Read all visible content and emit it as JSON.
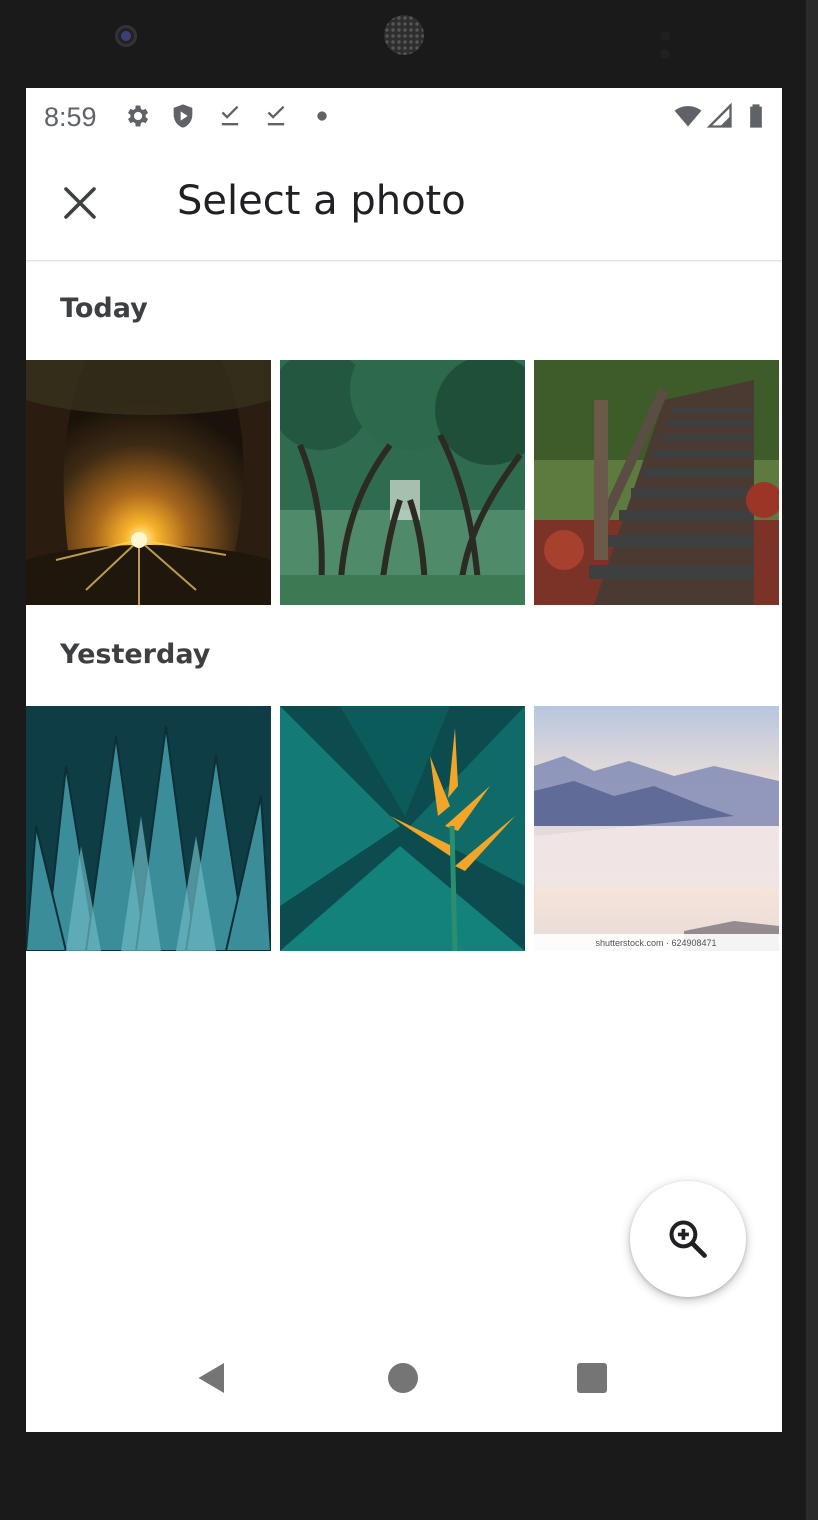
{
  "status_bar": {
    "time": "8:59",
    "left_icons": [
      "gear-icon",
      "shield-icon",
      "download-done-icon",
      "download-done-icon",
      "dot-icon"
    ],
    "right_icons": [
      "wifi-icon",
      "signal-icon",
      "battery-icon"
    ]
  },
  "app_bar": {
    "close_icon": "close-icon",
    "title": "Select a photo"
  },
  "sections": [
    {
      "label": "Today",
      "photos": [
        "sunset-forest-photo",
        "tree-avenue-photo",
        "wooden-stairs-autumn-photo"
      ]
    },
    {
      "label": "Yesterday",
      "photos": [
        "agave-plant-photo",
        "bird-of-paradise-photo",
        "misty-mountains-photo"
      ]
    }
  ],
  "watermark": "shutterstock.com · 624908471",
  "fab": {
    "icon": "zoom-in-icon"
  },
  "nav_bar": {
    "icons": [
      "back-icon",
      "home-icon",
      "recents-icon"
    ]
  },
  "colors": {
    "accent_text": "#202124",
    "icon_gray": "#5f6368",
    "section_label": "#3c4043"
  }
}
